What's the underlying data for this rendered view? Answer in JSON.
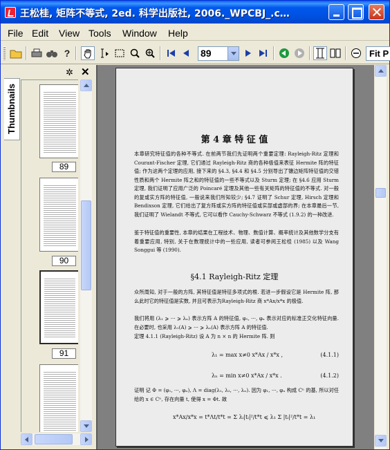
{
  "window": {
    "title": "王松桂, 矩阵不等式, 2ed. 科学出版社, 2006._WPCBJ_.c…"
  },
  "menu": [
    "File",
    "Edit",
    "View",
    "Tools",
    "Window",
    "Help"
  ],
  "toolbar": {
    "page_number": "89",
    "zoom_label": "Fit P"
  },
  "sidebar": {
    "tab_label": "Thumbnails",
    "thumbnails": [
      {
        "label": "89"
      },
      {
        "label": "90"
      },
      {
        "label": "91"
      }
    ]
  },
  "document": {
    "chapter_title": "第 4 章   特   征   值",
    "intro_para_1": "本章研究特征值的各种不等式. 在前两节我们先证明两个重要定理: Rayleigh-Ritz 定理和 Courant-Fischer 定理, 它们通过 Rayleigh-Ritz 商的各种极值来表征 Hermite 阵的特征值; 作为这两个定理的应用, 接下来的 §4.3, §4.4 和 §4.5 分别导出了镶边矩阵特征值的交错性质和两个 Hermite 阵之和的特征值的一些不等式以及 Sturm 定理; 在 §4.6 应用 Sturm 定理, 我们证明了应用广泛的 Poincaré 定理及其他一些有关矩阵的特征值的不等式. 对一般的复或实方阵的特征值, 一般说来我们所知较少; §4.7 证明了 Schur 定理, Hirsch 定理和 Bendixson 定理, 它们给出了复方阵或实方阵的特征值或实部或虚部的界; 在本章最后一节, 我们证明了 Wielandt 不等式, 它可以看作 Cauchy-Schwarz 不等式 (1.9.2) 的一种改进.",
    "intro_para_2": "鉴于特征值的重要性, 本章的结果在工程技术、物理、数值计算、概率统计及其他数学分支有着重要应用, 特别, 关于在数理统计中的一些应用, 读者可参阅王松桂 (1985) 以及 Wang Songgui 等 (1990).",
    "section_title": "§4.1   Rayleigh-Ritz 定理",
    "sec_para_1": "众所周知, 对于一般的方阵, 其特征值是特征多项式的根. 若进一步假设它是 Hermite 阵, 那么此时它的特征值是实数, 并且可表示为Rayleigh-Ritz 商 x*Ax/x*x 的极值.",
    "sec_para_2": "我们将用 (λ₁ ⩾ ··· ⩾ λₙ) 表示方阵 A 的特征值, φ₁, ···, φₙ 表示对应的标准正交化特征向量. 在必要时, 也采用 λ₁(A) ⩾ ··· ⩾ λₙ(A) 表示方阵 A 的特征值.",
    "theorem": "定理 4.1.1 (Rayleigh-Ritz)   设 A 为 n × n 的 Hermite 阵. 则",
    "eq1": "λ₁ = max x≠0  x*Ax / x*x ,",
    "eq1_no": "(4.1.1)",
    "eq2": "λₙ = min x≠0  x*Ax / x*x .",
    "eq2_no": "(4.1.2)",
    "proof": "证明   记 Φ = (φ₁, ···, φₙ), Λ = diag(λ₁, λ₂, ···, λₙ). 因为 φ₁, ···, φₙ 构成 Cⁿ 的基, 所以对任给的 x ∈ Cⁿ, 存在向量 t, 使得 x = Φt. 故",
    "eq3": "x*Ax/x*x = t*Λt/t*t = Σ λᵢ|tᵢ|²/t*t ⩽ λ₁ Σ |tᵢ|²/t*t = λ₁"
  }
}
